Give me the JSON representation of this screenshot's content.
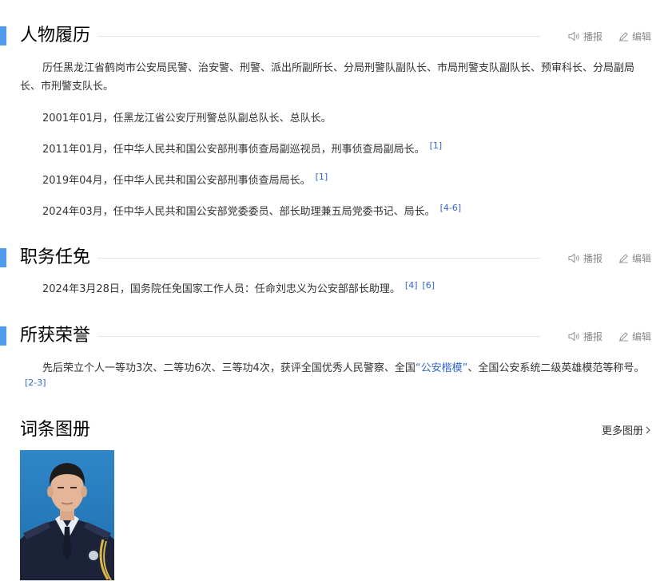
{
  "sections": [
    {
      "title": "人物履历",
      "tools": {
        "report": "播报",
        "edit": "编辑"
      },
      "paragraphs": [
        {
          "text": "历任黑龙江省鹤岗市公安局民警、治安警、刑警、派出所副所长、分局刑警队副队长、市局刑警支队副队长、预审科长、分局副局长、市刑警支队长。",
          "refs": []
        },
        {
          "text": "2001年01月，任黑龙江省公安厅刑警总队副总队长、总队长。",
          "refs": []
        },
        {
          "text": "2011年01月，任中华人民共和国公安部刑事侦查局副巡视员，刑事侦查局副局长。",
          "refs": [
            "[1]"
          ]
        },
        {
          "text": "2019年04月，任中华人民共和国公安部刑事侦查局局长。",
          "refs": [
            "[1]"
          ]
        },
        {
          "text": "2024年03月，任中华人民共和国公安部党委委员、部长助理兼五局党委书记、局长。",
          "refs": [
            "[4-6]"
          ]
        }
      ]
    },
    {
      "title": "职务任免",
      "tools": {
        "report": "播报",
        "edit": "编辑"
      },
      "paragraphs": [
        {
          "text": "2024年3月28日，国务院任免国家工作人员：任命刘忠义为公安部部长助理。",
          "refs": [
            "[4]",
            "[6]"
          ]
        }
      ]
    },
    {
      "title": "所获荣誉",
      "tools": {
        "report": "播报",
        "edit": "编辑"
      },
      "paragraphs": [
        {
          "text_before": "先后荣立个人一等功3次、二等功6次、三等功4次，获评全国优秀人民警察、全国",
          "link": "“公安楷模”",
          "text_after": "、全国公安系统二级英雄模范等称号。",
          "refs": [
            "[2-3]"
          ]
        }
      ]
    }
  ],
  "album": {
    "title": "词条图册",
    "more_label": "更多图册"
  },
  "icons": {
    "report": "speaker-icon",
    "edit": "pencil-icon",
    "more": "chevron-right-icon"
  },
  "colors": {
    "accent_bar": "#4f9cee",
    "link": "#3366cc",
    "tool_text": "#888888"
  }
}
